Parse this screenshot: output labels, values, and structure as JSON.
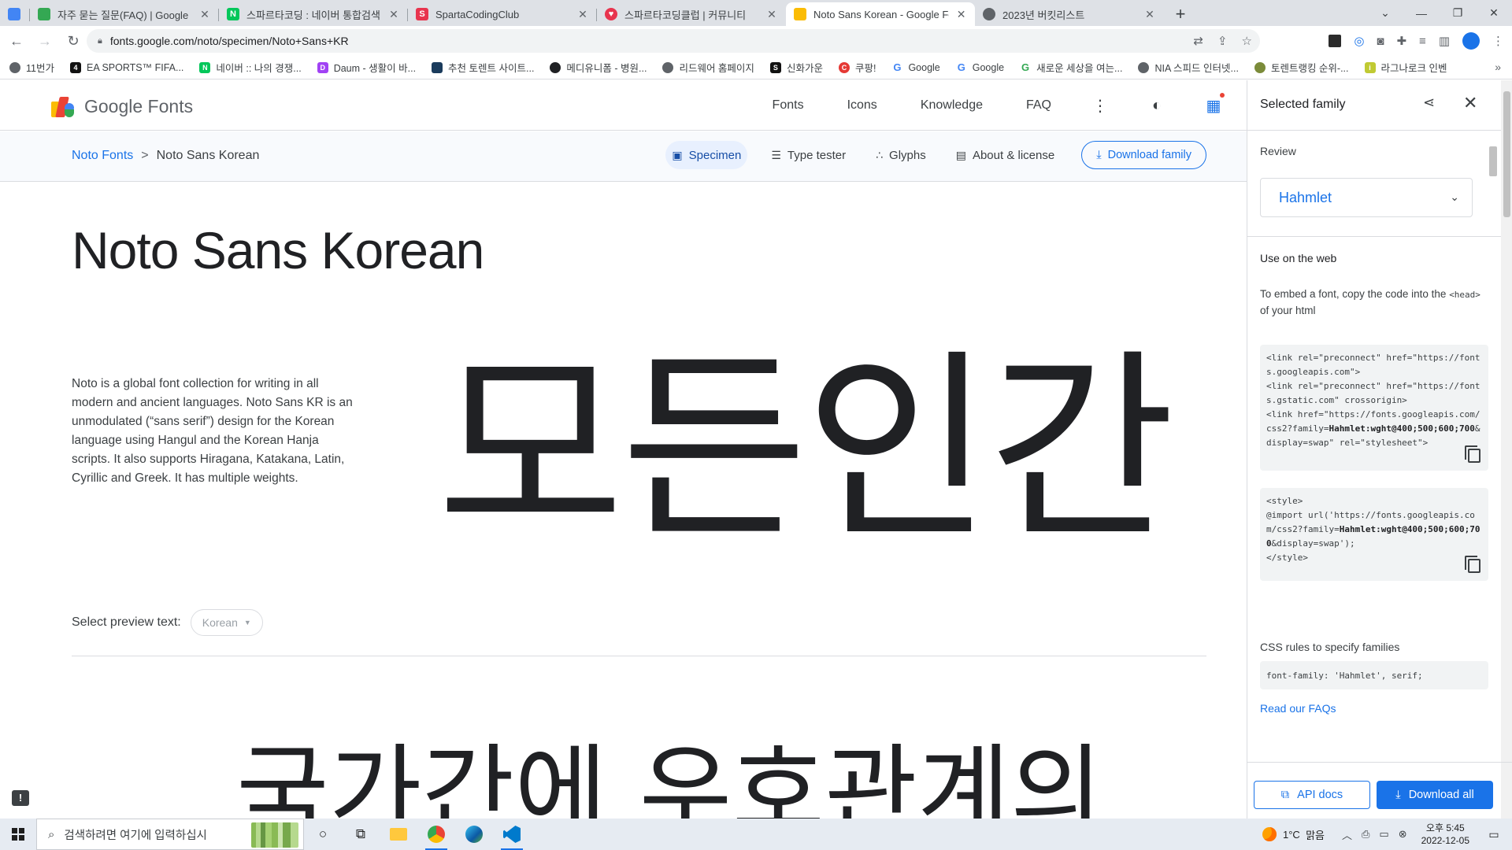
{
  "browser": {
    "tabs": [
      {
        "title": "",
        "favicon": "google-fonts-icon",
        "color": "#4285f4",
        "closable": false
      },
      {
        "title": "자주 묻는 질문(FAQ) | Google",
        "favicon": "google-fonts-icon",
        "color": "#34a853",
        "closable": true
      },
      {
        "title": "스파르타코딩 : 네이버 통합검색",
        "favicon": "naver-icon",
        "color": "#03c75a",
        "closable": true
      },
      {
        "title": "SpartaCodingClub",
        "favicon": "sparta-icon",
        "color": "#e8344e",
        "closable": true
      },
      {
        "title": "스파르타코딩클럽 | 커뮤니티",
        "favicon": "heart-icon",
        "color": "#e8344e",
        "closable": true
      },
      {
        "title": "Noto Sans Korean - Google Fon",
        "favicon": "google-fonts-icon",
        "color": "#fbbc04",
        "closable": true,
        "active": true
      },
      {
        "title": "2023년 버킷리스트",
        "favicon": "globe-icon",
        "color": "#5f6368",
        "closable": true
      }
    ],
    "new_tab": "+",
    "window_controls": [
      "⌄",
      "—",
      "❐",
      "✕"
    ],
    "url": "fonts.google.com/noto/specimen/Noto+Sans+KR",
    "bookmarks": [
      {
        "label": "11번가",
        "icon": "globe-icon",
        "color": "#5f6368"
      },
      {
        "label": "EA SPORTS™ FIFA...",
        "icon": "ea-icon",
        "color": "#111111"
      },
      {
        "label": "네이버 :: 나의 경쟁...",
        "icon": "naver-icon",
        "color": "#03c75a"
      },
      {
        "label": "Daum - 생활이 바...",
        "icon": "daum-icon",
        "color": "#a142f4"
      },
      {
        "label": "추천 토렌트 사이트...",
        "icon": "torrent-icon",
        "color": "#1a3b5c"
      },
      {
        "label": "메디유니폼 - 병원...",
        "icon": "medi-icon",
        "color": "#202124"
      },
      {
        "label": "리드웨어 홈페이지",
        "icon": "globe-icon",
        "color": "#5f6368"
      },
      {
        "label": "신화가운",
        "icon": "s-icon",
        "color": "#111111"
      },
      {
        "label": "쿠팡!",
        "icon": "coupang-icon",
        "color": "#e53935"
      },
      {
        "label": "Google",
        "icon": "google-icon",
        "color": "#4285f4"
      },
      {
        "label": "Google",
        "icon": "google-icon",
        "color": "#4285f4"
      },
      {
        "label": "새로운 세상을 여는...",
        "icon": "g-icon",
        "color": "#34a853"
      },
      {
        "label": "NIA 스피드 인터넷...",
        "icon": "globe-icon",
        "color": "#5f6368"
      },
      {
        "label": "토렌트랭킹 순위-...",
        "icon": "rank-icon",
        "color": "#7b8b3a"
      },
      {
        "label": "라그나로크 인벤",
        "icon": "inven-icon",
        "color": "#c0ca33"
      }
    ],
    "bookmarks_more": "»"
  },
  "header": {
    "brand": "Google Fonts",
    "nav": [
      "Fonts",
      "Icons",
      "Knowledge",
      "FAQ"
    ]
  },
  "subbar": {
    "crumb_parent": "Noto Fonts",
    "crumb_sep": ">",
    "crumb_current": "Noto Sans Korean",
    "sections": [
      {
        "label": "Specimen",
        "icon": "specimen-icon",
        "glyph": "▣",
        "active": true
      },
      {
        "label": "Type tester",
        "icon": "sliders-icon",
        "glyph": "☰",
        "active": false
      },
      {
        "label": "Glyphs",
        "icon": "glyphs-icon",
        "glyph": "∴",
        "active": false
      },
      {
        "label": "About & license",
        "icon": "document-icon",
        "glyph": "▤",
        "active": false
      }
    ],
    "download": "Download family"
  },
  "main": {
    "family_name": "Noto Sans Korean",
    "description": "Noto is a global font collection for writing in all modern and ancient languages. Noto Sans KR is an unmodulated (“sans serif”) design for the Korean language using Hangul and the Korean Hanja scripts. It also supports Hiragana, Katakana, Latin, Cyrillic and Greek. It has multiple weights.",
    "preview_text": "모든인간",
    "select_preview_label": "Select preview text:",
    "select_preview_value": "Korean",
    "preview_text_2": "국가간에 우호관계의"
  },
  "panel": {
    "title": "Selected family",
    "review_label": "Review",
    "review_value": "Hahmlet",
    "web_heading": "Use on the web",
    "embed_text_1": "To embed a font, copy the code into the",
    "embed_code_tag": "<head>",
    "embed_text_2": "of your html",
    "link_code_1": "<link rel=\"preconnect\" href=\"https://fonts.googleapis.com\">\n<link rel=\"preconnect\" href=\"https://fonts.gstatic.com\" crossorigin>\n<link href=\"https://fonts.googleapis.com/css2?family=",
    "link_code_bold": "Hahmlet:wght@400;500;600;700",
    "link_code_2": "&display=swap\" rel=\"stylesheet\">",
    "import_code_1": "<style>\n@import url('https://fonts.googleapis.com/css2?family=",
    "import_code_bold": "Hahmlet:wght@400;500;600;700",
    "import_code_2": "&display=swap');\n</style>",
    "css_rules_label": "CSS rules to specify families",
    "css_rule": "font-family: 'Hahmlet', serif;",
    "faq_link": "Read our FAQs",
    "api_docs": "API docs",
    "download_all": "Download all"
  },
  "taskbar": {
    "search_placeholder": "검색하려면 여기에 입력하십시",
    "weather_temp": "1°C",
    "weather_desc": "맑음",
    "time": "오후 5:45",
    "date": "2022-12-05"
  },
  "colors": {
    "accent": "#1a73e8",
    "active_section_bg": "#e8f0fe"
  }
}
